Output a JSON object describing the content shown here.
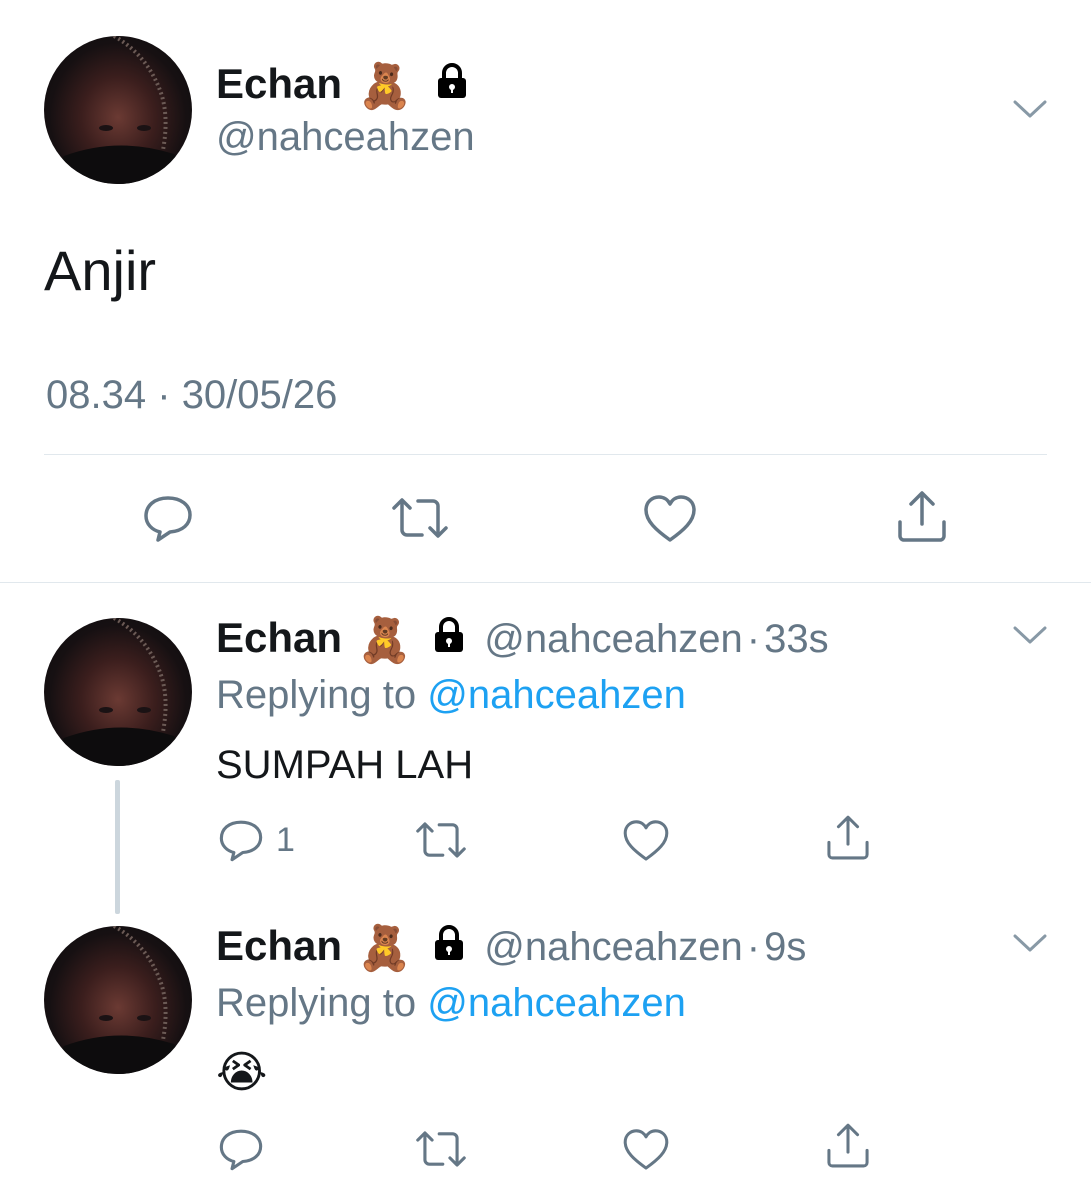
{
  "main_tweet": {
    "author_name": "Echan",
    "author_emoji": "🧸",
    "handle": "@nahceahzen",
    "text": "Anjir",
    "time": "08.34",
    "separator": "·",
    "date": "30/05/26",
    "lock_icon": "lock-icon",
    "menu_icon": "chevron-down-icon"
  },
  "replies": [
    {
      "author_name": "Echan",
      "author_emoji": "🧸",
      "handle": "@nahceahzen",
      "separator": "·",
      "age": "33s",
      "replying_prefix": "Replying to",
      "replying_to": "@nahceahzen",
      "text": "SUMPAH LAH",
      "reply_count": "1"
    },
    {
      "author_name": "Echan",
      "author_emoji": "🧸",
      "handle": "@nahceahzen",
      "separator": "·",
      "age": "9s",
      "replying_prefix": "Replying to",
      "replying_to": "@nahceahzen",
      "text": "😭",
      "reply_count": ""
    }
  ],
  "actions": [
    "reply-icon",
    "retweet-icon",
    "like-icon",
    "share-icon"
  ],
  "colors": {
    "accent": "#1da1f2",
    "secondary_text": "#657786",
    "icon": "#657786",
    "divider": "#e1e8ed",
    "thread_line": "#ccd6dd"
  }
}
